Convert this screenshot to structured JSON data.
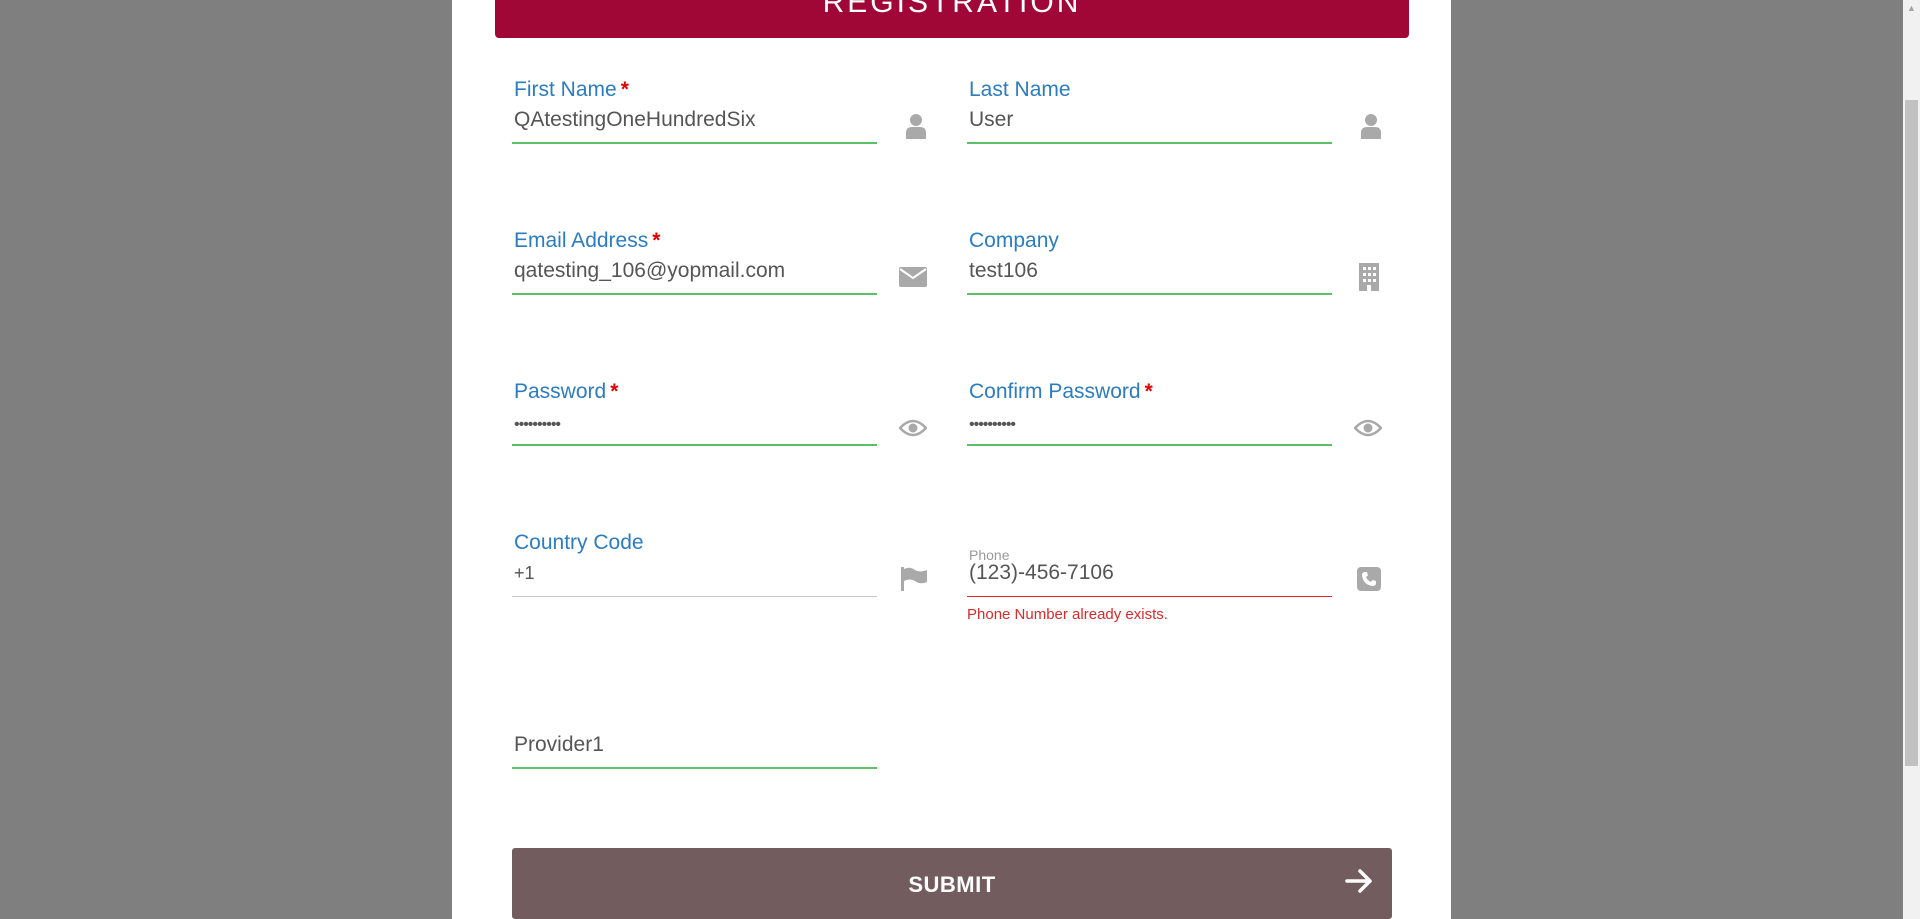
{
  "header": {
    "title": "REGISTRATION"
  },
  "form": {
    "first_name": {
      "label": "First Name",
      "required": "*",
      "value": "QAtestingOneHundredSix",
      "icon": "user-icon"
    },
    "last_name": {
      "label": "Last Name",
      "value": "User",
      "icon": "user-icon"
    },
    "email": {
      "label": "Email Address",
      "required": "*",
      "value": "qatesting_106@yopmail.com",
      "icon": "envelope-icon"
    },
    "company": {
      "label": "Company",
      "value": "test106",
      "icon": "building-icon"
    },
    "password": {
      "label": "Password",
      "required": "*",
      "value": "••••••••••",
      "icon": "eye-icon"
    },
    "confirm_password": {
      "label": "Confirm Password",
      "required": "*",
      "value": "••••••••••",
      "icon": "eye-icon"
    },
    "country_code": {
      "label": "Country Code",
      "value": "+1",
      "icon": "flag-icon"
    },
    "phone": {
      "label": "Phone",
      "value": "(123)-456-7106",
      "error": "Phone Number already exists.",
      "icon": "phone-icon"
    },
    "provider": {
      "value": "Provider1"
    }
  },
  "submit": {
    "label": "SUBMIT",
    "icon": "arrow-right-icon"
  },
  "colors": {
    "header": "#a00736",
    "label": "#2b7cc0",
    "valid_underline": "#5cc068",
    "error": "#d82a2a",
    "submit": "#735c5e",
    "overlay": "#7f7f7f"
  }
}
